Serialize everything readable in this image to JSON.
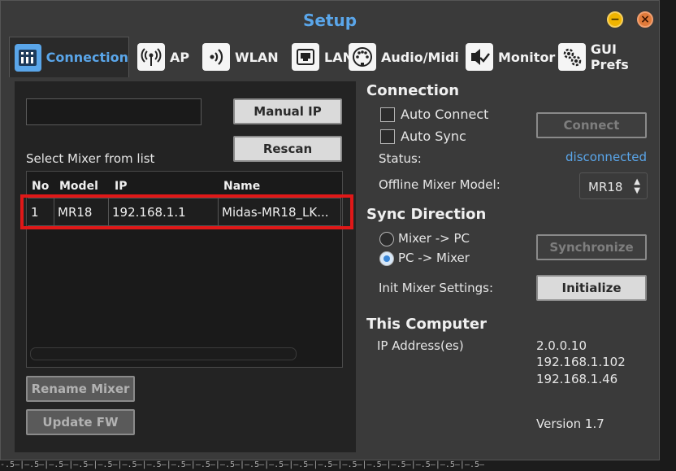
{
  "window": {
    "title": "Setup",
    "minimize_icon": "minus-icon",
    "close_icon": "close-x-icon"
  },
  "tabs": [
    {
      "label": "Connection",
      "icon": "mixer-icon",
      "active": true
    },
    {
      "label": "AP",
      "icon": "antenna-icon"
    },
    {
      "label": "WLAN",
      "icon": "wifi-icon"
    },
    {
      "label": "LAN",
      "icon": "ethernet-port-icon"
    },
    {
      "label": "Audio/Midi",
      "icon": "midi-connector-icon"
    },
    {
      "label": "Monitor",
      "icon": "monitor-check-icon"
    },
    {
      "label": "GUI Prefs",
      "icon": "gears-icon"
    }
  ],
  "left": {
    "ip_input_value": "",
    "manual_ip": "Manual IP",
    "rescan": "Rescan",
    "select_label": "Select Mixer from list",
    "table": {
      "columns": [
        "No",
        "Model",
        "IP",
        "Name"
      ],
      "rows": [
        [
          "1",
          "MR18",
          "192.168.1.1",
          "Midas-MR18_LK..."
        ]
      ]
    },
    "rename_mixer": "Rename Mixer",
    "update_fw": "Update FW"
  },
  "connection": {
    "heading": "Connection",
    "auto_connect": "Auto Connect",
    "auto_sync": "Auto Sync",
    "status_label": "Status:",
    "status_value": "disconnected",
    "connect": "Connect",
    "offline_label": "Offline Mixer Model:",
    "offline_value": "MR18"
  },
  "sync": {
    "heading": "Sync Direction",
    "opt1": "Mixer -> PC",
    "opt2": "PC -> Mixer",
    "selected": "PC -> Mixer",
    "synchronize": "Synchronize",
    "init_label": "Init Mixer Settings:",
    "initialize": "Initialize"
  },
  "computer": {
    "heading": "This Computer",
    "ip_label": "IP Address(es)",
    "ips": [
      "2.0.0.10",
      "192.168.1.102",
      "192.168.1.46"
    ],
    "version": "Version 1.7"
  },
  "colors": {
    "accent": "#5aa6ea",
    "highlight": "#e01818",
    "window_bg": "#3a3a3a"
  }
}
